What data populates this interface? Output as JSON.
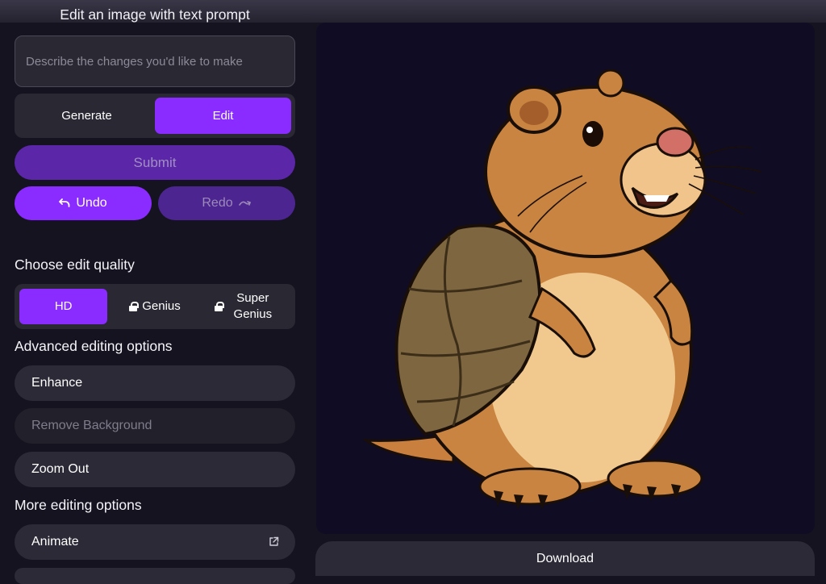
{
  "panel": {
    "title": "Edit an image with text prompt",
    "prompt_placeholder": "Describe the changes you'd like to make",
    "prompt_value": ""
  },
  "mode": {
    "generate_label": "Generate",
    "edit_label": "Edit",
    "active": "Edit"
  },
  "actions": {
    "submit_label": "Submit",
    "undo_label": "Undo",
    "redo_label": "Redo"
  },
  "quality": {
    "title": "Choose edit quality",
    "options": [
      {
        "label": "HD",
        "locked": false,
        "active": true
      },
      {
        "label": "Genius",
        "locked": true,
        "active": false
      },
      {
        "label": "Super Genius",
        "locked": true,
        "active": false
      }
    ]
  },
  "advanced": {
    "title": "Advanced editing options",
    "options": [
      {
        "label": "Enhance",
        "disabled": false
      },
      {
        "label": "Remove Background",
        "disabled": true
      },
      {
        "label": "Zoom Out",
        "disabled": false
      }
    ]
  },
  "more": {
    "title": "More editing options",
    "options": [
      {
        "label": "Animate",
        "icon": "external-link-icon"
      }
    ]
  },
  "canvas": {
    "image_subject": "capybara-with-turtle-shell-illustration"
  },
  "download_label": "Download",
  "colors": {
    "accent": "#8a2bff",
    "submit": "#5b26a8",
    "redo": "#4c2591",
    "canvas_bg": "#0f0c23",
    "panel_bg": "#15131f"
  }
}
